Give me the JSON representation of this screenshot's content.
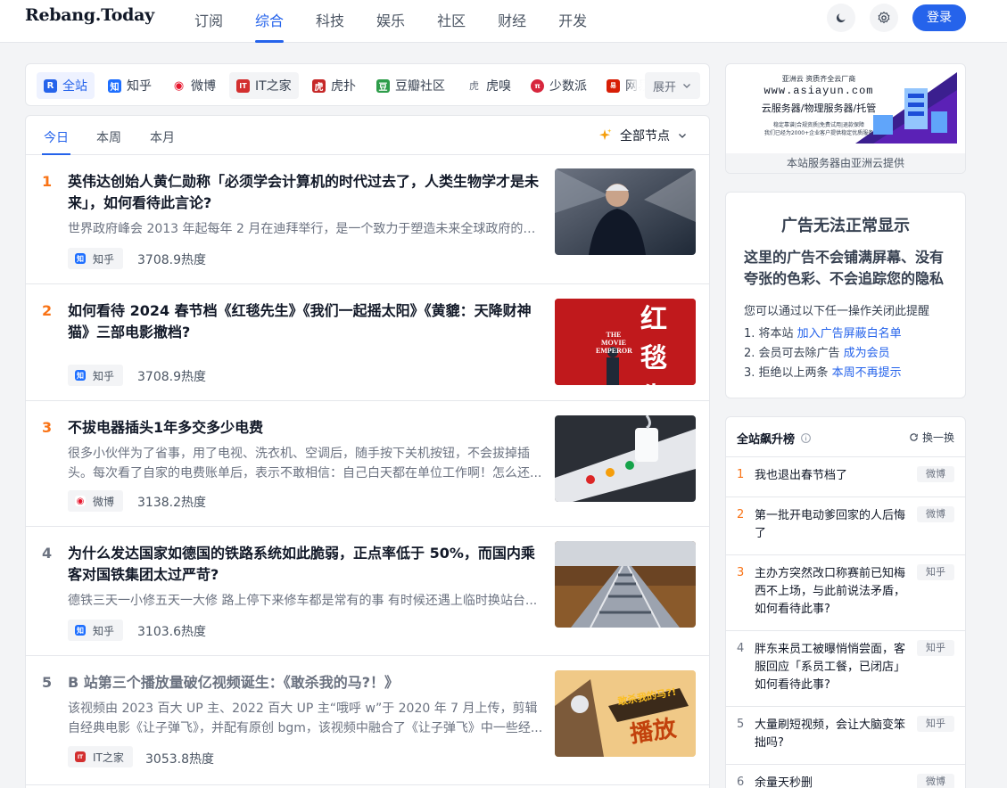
{
  "header": {
    "logo": "Rebang.Today",
    "nav": [
      "订阅",
      "综合",
      "科技",
      "娱乐",
      "社区",
      "财经",
      "开发"
    ],
    "login": "登录",
    "icons": [
      "moon-icon",
      "gear-icon"
    ]
  },
  "sources": {
    "items": [
      "全站",
      "知乎",
      "微博",
      "IT之家",
      "虎扑",
      "豆瓣社区",
      "虎嗅",
      "少数派",
      "网易"
    ],
    "expand": "展开"
  },
  "tabs": {
    "periods": [
      "今日",
      "本周",
      "本月"
    ],
    "node_filter": "全部节点"
  },
  "list": [
    {
      "rank": "1",
      "title": "英伟达创始人黄仁勋称「必须学会计算机的时代过去了，人类生物学才是未来」，如何看待此言论?",
      "desc": "世界政府峰会 2013 年起每年 2 月在迪拜举行，是一个致力于塑造未来全球政府的全...",
      "source": "知乎",
      "heat": "3708.9热度"
    },
    {
      "rank": "2",
      "title": "如何看待 2024 春节档《红毯先生》《我们一起摇太阳》《黄貔：天降财神猫》三部电影撤档?",
      "desc": "",
      "source": "知乎",
      "heat": "3708.9热度"
    },
    {
      "rank": "3",
      "title": "不拔电器插头1年多交多少电费",
      "desc": "很多小伙伴为了省事，用了电视、洗衣机、空调后，随手按下关机按钮，不会拔掉插头。每次看了自家的电费账单后，表示不敢相信：自己白天都在单位工作啊！怎么还...",
      "source": "微博",
      "heat": "3138.2热度"
    },
    {
      "rank": "4",
      "title": "为什么发达国家如德国的铁路系统如此脆弱，正点率低于 50%，而国内乘客对国铁集团太过严苛?",
      "desc": "德铁三天一小修五天一大修 路上停下来修车都是常有的事 有时候还遇上临时换站台...",
      "source": "知乎",
      "heat": "3103.6热度"
    },
    {
      "rank": "5",
      "title": "B 站第三个播放量破亿视频诞生：《敢杀我的马?！》",
      "desc": "该视频由 2023 百大 UP 主、2022 百大 UP 主“哦呼 w”于 2020 年 7 月上传，剪辑自经典电影《让子弹飞》，并配有原创 bgm，该视频中融合了《让子弹飞》中一些经...",
      "source": "IT之家",
      "heat": "3053.8热度"
    }
  ],
  "thumb_texts": {
    "movie_1": "THE MOVIE EMPEROR",
    "movie_2": "红毯先生",
    "bili_1": "敢杀我的马?!",
    "bili_2": "播放"
  },
  "ad": {
    "banner_line1": "亚洲云 资质齐全云厂商",
    "banner_url": "www.asiayun.com",
    "banner_line2": "云服务器/物理服务器/托管",
    "banner_line3": "稳定靠谱|合规资质|免费试用|退款保障",
    "banner_line4": "我们已经为2000+企业客户提供稳定优质服务",
    "caption": "本站服务器由亚洲云提供"
  },
  "notice": {
    "title": "广告无法正常显示",
    "subtitle": "这里的广告不会铺满屏幕、没有夸张的色彩、不会追踪您的隐私",
    "intro": "您可以通过以下任一操作关闭此提醒",
    "options": [
      {
        "text": "1. 将本站 ",
        "link": "加入广告屏蔽白名单"
      },
      {
        "text": "2. 会员可去除广告 ",
        "link": "成为会员"
      },
      {
        "text": "3. 拒绝以上两条 ",
        "link": "本周不再提示"
      }
    ]
  },
  "rising": {
    "title": "全站飙升榜",
    "refresh": "换一换",
    "items": [
      {
        "rank": "1",
        "text": "我也退出春节档了",
        "source": "微博"
      },
      {
        "rank": "2",
        "text": "第一批开电动爹回家的人后悔了",
        "source": "微博"
      },
      {
        "rank": "3",
        "text": "主办方突然改口称赛前已知梅西不上场，与此前说法矛盾，如何看待此事?",
        "source": "知乎"
      },
      {
        "rank": "4",
        "text": "胖东来员工被曝悄悄尝面，客服回应「系员工餐，已闭店」如何看待此事?",
        "source": "知乎"
      },
      {
        "rank": "5",
        "text": "大量刷短视频，会让大脑变笨拙吗?",
        "source": "知乎"
      },
      {
        "rank": "6",
        "text": "余量天秒删",
        "source": "微博"
      }
    ]
  },
  "colors": {
    "accent": "#2563eb",
    "rank_top": "#f97316",
    "rank_other": "#6b7280"
  }
}
